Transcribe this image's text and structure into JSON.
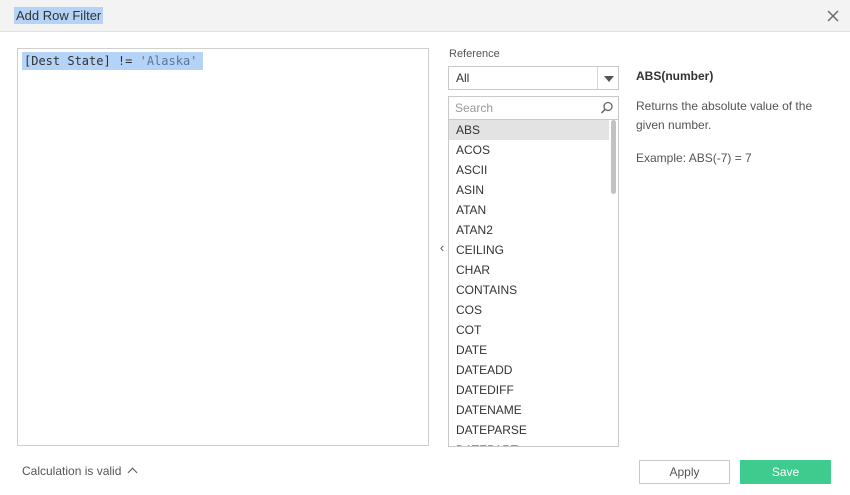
{
  "dialog": {
    "title": "Add Row Filter",
    "close_icon": "close-icon"
  },
  "editor": {
    "formula_field": "[Dest State]",
    "formula_operator": " != ",
    "formula_string": "'Alaska'"
  },
  "reference": {
    "label": "Reference",
    "category_selected": "All",
    "search_placeholder": "Search",
    "functions": [
      "ABS",
      "ACOS",
      "ASCII",
      "ASIN",
      "ATAN",
      "ATAN2",
      "CEILING",
      "CHAR",
      "CONTAINS",
      "COS",
      "COT",
      "DATE",
      "DATEADD",
      "DATEDIFF",
      "DATENAME",
      "DATEPARSE",
      "DATEPART"
    ],
    "selected_function": "ABS"
  },
  "help": {
    "signature": "ABS(number)",
    "description": "Returns the absolute value of the given number.",
    "example": "Example: ABS(-7) = 7"
  },
  "footer": {
    "status": "Calculation is valid",
    "apply_label": "Apply",
    "save_label": "Save"
  },
  "colors": {
    "selection_highlight": "#b4d3f7",
    "save_button": "#3ecb8d",
    "selected_row": "#e3e3e3"
  }
}
